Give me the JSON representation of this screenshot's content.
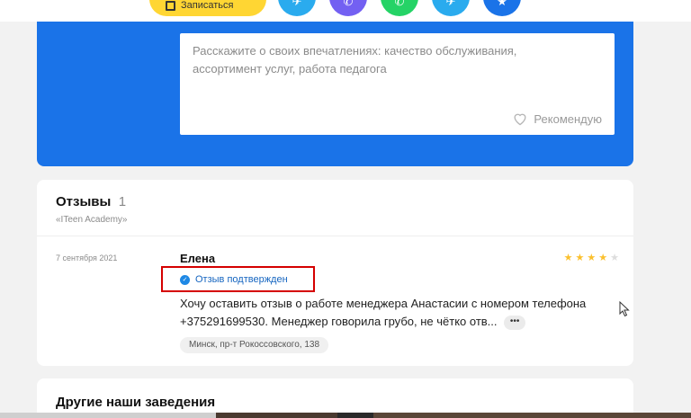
{
  "top_actions": {
    "yellow_button_label": "Записаться",
    "share_icons": [
      {
        "name": "telegram-share-icon",
        "color": "#2aabee",
        "glyph": "✈"
      },
      {
        "name": "viber-share-icon",
        "color": "#7360f2",
        "glyph": "✆"
      },
      {
        "name": "whatsapp-share-icon",
        "color": "#25d366",
        "glyph": "✆"
      },
      {
        "name": "telegram-share-icon-alt",
        "color": "#2aabee",
        "glyph": "✈"
      },
      {
        "name": "bookmark-share-icon",
        "color": "#1a73e8",
        "glyph": "★"
      }
    ]
  },
  "review_form": {
    "placeholder": "Расскажите о своих впечатлениях: качество обслуживания, ассортимент услуг, работа педагога",
    "recommend_label": "Рекомендую",
    "accent": "#1a73e8"
  },
  "reviews": {
    "title": "Отзывы",
    "count": "1",
    "subtitle": "«ITeen Academy»",
    "items": [
      {
        "date": "7 сентября 2021",
        "author": "Елена",
        "rating": 4,
        "max_rating": 5,
        "verified_label": "Отзыв подтвержден",
        "text": "Хочу оставить отзыв о работе менеджера Анастасии с номером телефона +375291699530. Менеджер говорила грубо, не чётко отв...",
        "more_label": "•••",
        "address": "Минск, пр-т Рокоссовского, 138"
      }
    ]
  },
  "other_places": {
    "title": "Другие наши заведения"
  },
  "colors": {
    "star_filled": "#fbc02d",
    "star_empty": "#dddddd",
    "highlight_border": "#d50000",
    "verified": "#1e88e5"
  }
}
